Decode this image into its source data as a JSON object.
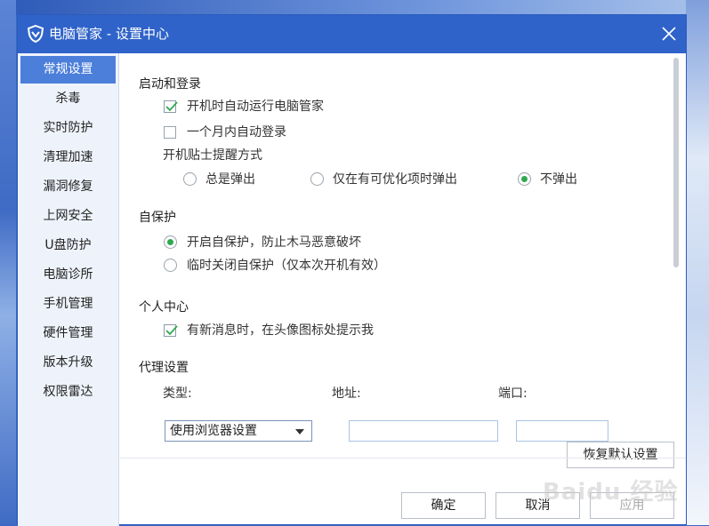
{
  "window": {
    "title": "电脑管家 - 设置中心"
  },
  "sidebar": {
    "items": [
      {
        "label": "常规设置",
        "active": true
      },
      {
        "label": "杀毒"
      },
      {
        "label": "实时防护"
      },
      {
        "label": "清理加速"
      },
      {
        "label": "漏洞修复"
      },
      {
        "label": "上网安全"
      },
      {
        "label": "U盘防护"
      },
      {
        "label": "电脑诊所"
      },
      {
        "label": "手机管理"
      },
      {
        "label": "硬件管理"
      },
      {
        "label": "版本升级"
      },
      {
        "label": "权限雷达"
      }
    ]
  },
  "startup": {
    "title": "启动和登录",
    "autorun": {
      "label": "开机时自动运行电脑管家",
      "checked": true
    },
    "autologin": {
      "label": "一个月内自动登录",
      "checked": false
    },
    "tips_title": "开机贴士提醒方式",
    "tips_options": [
      {
        "label": "总是弹出",
        "selected": false
      },
      {
        "label": "仅在有可优化项时弹出",
        "selected": false
      },
      {
        "label": "不弹出",
        "selected": true
      }
    ]
  },
  "selfprotect": {
    "title": "自保护",
    "on": {
      "label": "开启自保护，防止木马恶意破坏",
      "selected": true
    },
    "off": {
      "label": "临时关闭自保护（仅本次开机有效）",
      "selected": false
    }
  },
  "personal": {
    "title": "个人中心",
    "notify": {
      "label": "有新消息时，在头像图标处提示我",
      "checked": true
    }
  },
  "proxy": {
    "title": "代理设置",
    "type_label": "类型:",
    "type_value": "使用浏览器设置",
    "address_label": "地址:",
    "port_label": "端口:",
    "address_value": "",
    "port_value": "",
    "restore_label": "恢复默认设置"
  },
  "footer": {
    "ok": "确定",
    "cancel": "取消",
    "apply": "应用"
  },
  "watermark": "Baidu 经验",
  "colors": {
    "titlebar": "#2f63c9",
    "active": "#4c7fda",
    "radio_on": "#2fa84f"
  }
}
